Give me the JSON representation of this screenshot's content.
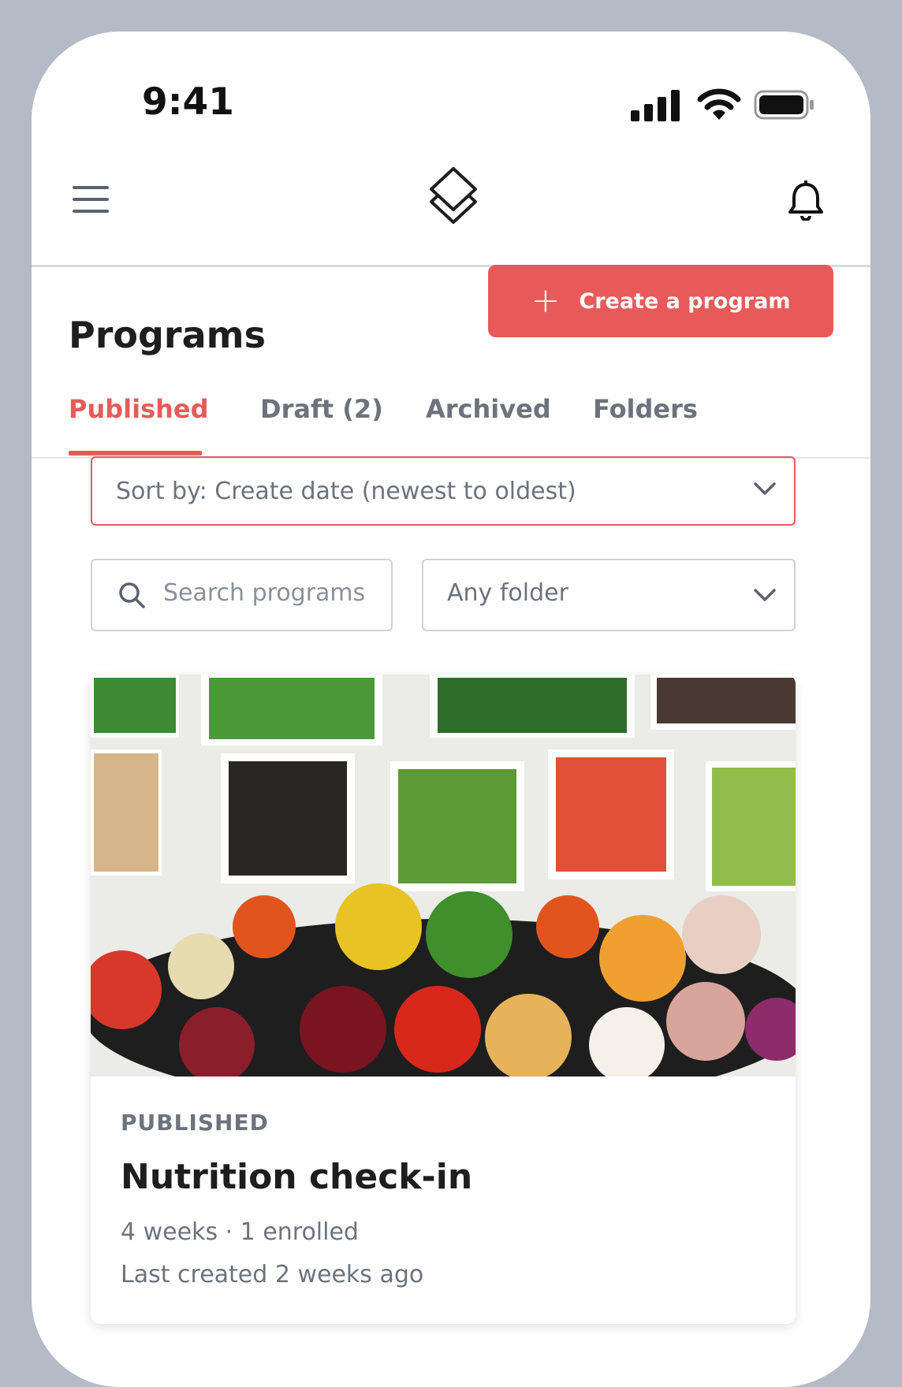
{
  "status_bar": {
    "time": "9:41"
  },
  "nav": {
    "menu_icon": "hamburger-icon",
    "logo_icon": "stacked-squares-logo",
    "notification_icon": "bell-icon"
  },
  "header": {
    "title": "Programs",
    "create_button_label": "Create a program"
  },
  "tabs": [
    {
      "label": "Published",
      "active": true
    },
    {
      "label": "Draft (2)",
      "active": false
    },
    {
      "label": "Archived",
      "active": false
    },
    {
      "label": "Folders",
      "active": false
    }
  ],
  "filters": {
    "sort_label": "Sort by: Create date (newest to oldest)",
    "search_placeholder": "Search programs",
    "folder_label": "Any folder"
  },
  "program_card": {
    "status": "PUBLISHED",
    "title": "Nutrition check-in",
    "meta": "4 weeks  ·  1 enrolled",
    "updated": "Last created 2 weeks ago"
  },
  "colors": {
    "accent": "#e85a5a",
    "frame": "#b4bbc6",
    "text_muted": "#6c737d"
  }
}
